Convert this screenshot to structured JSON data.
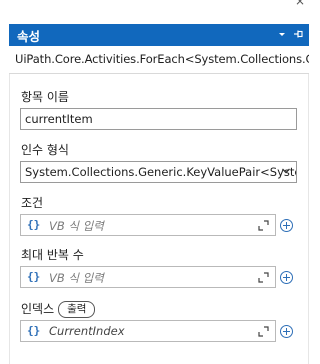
{
  "window": {
    "close_glyph": "×"
  },
  "properties_panel": {
    "title": "속성",
    "pin_icon": "pin-icon",
    "dropdown_icon": "chevron-down-icon",
    "activity_type": "UiPath.Core.Activities.ForEach<System.Collections.G..."
  },
  "fields": {
    "item_name": {
      "label": "항목 이름",
      "value": "currentItem"
    },
    "type_argument": {
      "label": "인수 형식",
      "value": "System.Collections.Generic.KeyValuePair<Syste"
    },
    "condition": {
      "label": "조건",
      "brace": "{}",
      "placeholder": "VB 식 입력"
    },
    "max_iterations": {
      "label": "최대 반복 수",
      "brace": "{}",
      "placeholder": "VB 식 입력"
    },
    "index": {
      "label": "인덱스",
      "badge": "출력",
      "brace": "{}",
      "value": "CurrentIndex"
    }
  },
  "colors": {
    "header_bg": "#1168bd",
    "accent": "#2e6fb7"
  }
}
